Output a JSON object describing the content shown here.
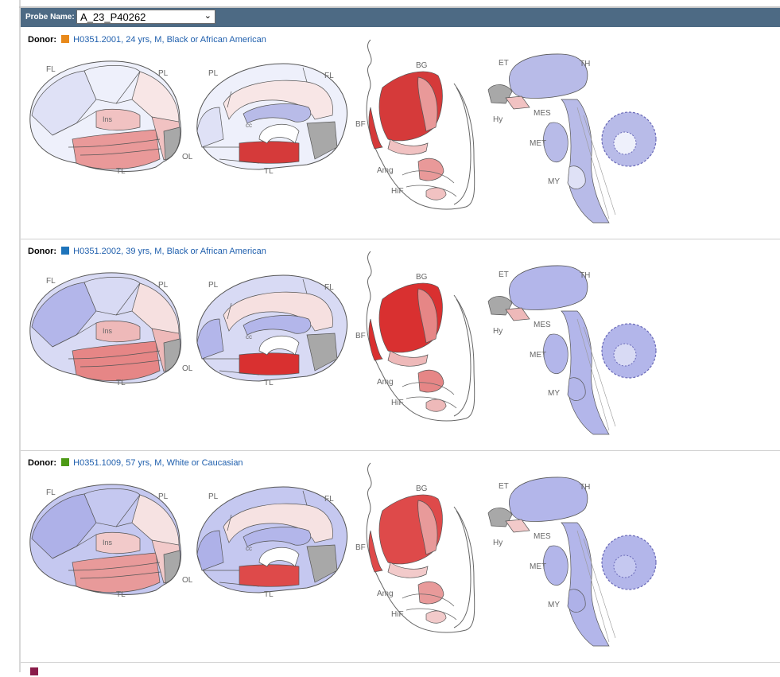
{
  "probe": {
    "label": "Probe Name:",
    "selected": "A_23_P40262"
  },
  "region_labels": {
    "frontal": "FL",
    "parietal": "PL",
    "insula": "Ins",
    "occipital": "OL",
    "temporal": "TL",
    "corpus_callosum": "cc",
    "basal_ganglia": "BG",
    "basal_forebrain": "BF",
    "amygdala": "Amg",
    "hippocampus": "HiF",
    "epithalamus": "ET",
    "thalamus": "TH",
    "hypothalamus": "Hy",
    "mesencephalon": "MES",
    "metencephalon": "MET",
    "myelencephalon": "MY"
  },
  "donor_label": "Donor:",
  "donors": [
    {
      "id": "H0351.2001",
      "text": "H0351.2001, 24 yrs, M, Black or African American",
      "swatch": "#e8891a",
      "expression": [
        "#eef0fb",
        "#dfe1f6",
        "#f8e6e6",
        "#f1c2c2",
        "#e99999",
        "#d53a3a",
        "#a8a8a8",
        "#b8bbe8"
      ]
    },
    {
      "id": "H0351.2002",
      "text": "H0351.2002, 39 yrs, M, Black or African American",
      "swatch": "#1e74bb",
      "expression": [
        "#d8daf4",
        "#b3b6ea",
        "#f6e0e0",
        "#eeb9b9",
        "#e68686",
        "#d93030",
        "#a8a8a8",
        "#b3b6ea"
      ]
    },
    {
      "id": "H0351.1009",
      "text": "H0351.1009, 57 yrs, M, White or Caucasian",
      "swatch": "#4d9a16",
      "expression": [
        "#c5c8f0",
        "#aeb1e8",
        "#f6e2e2",
        "#f2caca",
        "#e89a9a",
        "#de4a4a",
        "#a8a8a8",
        "#b3b6ea"
      ]
    }
  ],
  "partial_donor": {
    "swatch": "#8a1c4a"
  }
}
